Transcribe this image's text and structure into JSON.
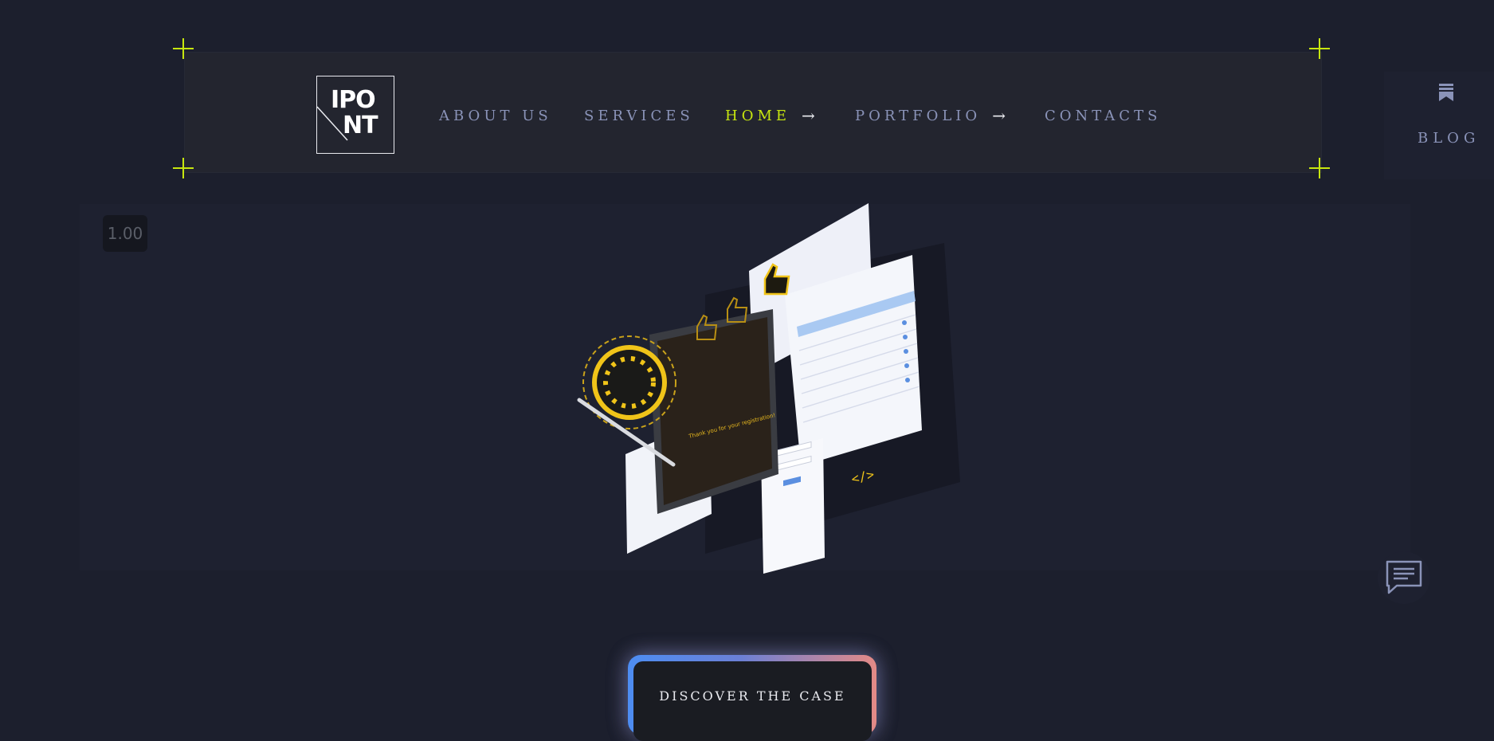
{
  "nav": {
    "items": [
      {
        "label": "ABOUT US",
        "arrow": ""
      },
      {
        "label": "SERVICES",
        "arrow": ""
      },
      {
        "label": "HOME",
        "arrow": "→"
      },
      {
        "label": "PORTFOLIO",
        "arrow": "→"
      },
      {
        "label": "CONTACTS",
        "arrow": ""
      }
    ],
    "active": "HOME"
  },
  "logo": {
    "line1": "IPO",
    "line2": "NT"
  },
  "blog": {
    "label": "BLOG"
  },
  "zoom_badge": "1.00",
  "hero": {
    "illustration": "isometric-ui-screens-illustration",
    "tablet_text": "Thank you for your registration!",
    "code_tag": "</>"
  },
  "cta": {
    "label": "DISCOVER THE CASE"
  },
  "colors": {
    "background": "#1c1f2d",
    "accent": "#c7e60f",
    "nav_text": "#8a93b8",
    "cta_gradient_start": "#4d8df2",
    "cta_gradient_end": "#e48a86"
  },
  "icons": {
    "bookmark": "bookmark-icon",
    "chat": "chat-icon"
  }
}
